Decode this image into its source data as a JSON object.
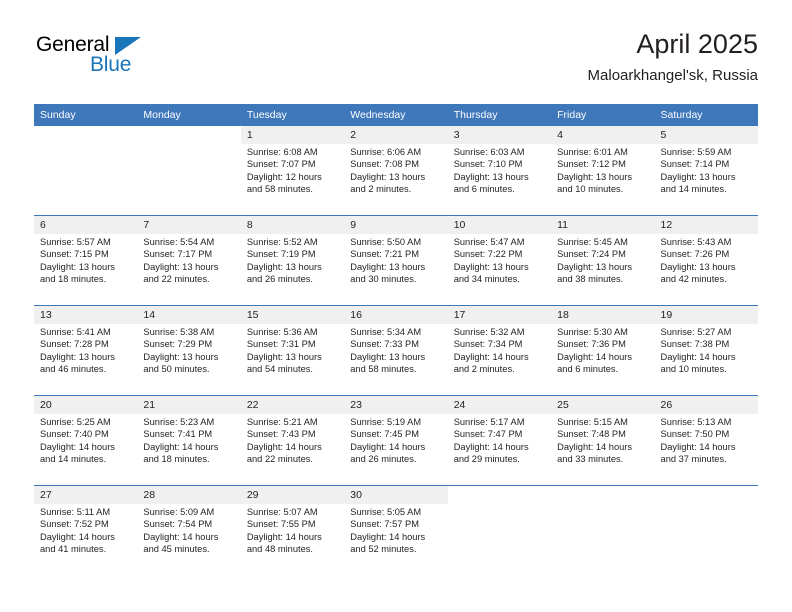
{
  "brand": {
    "name_top": "General",
    "name_bottom": "Blue",
    "accent_color": "#1b75bb"
  },
  "header": {
    "title": "April 2025",
    "location": "Maloarkhangel'sk, Russia"
  },
  "theme": {
    "header_row_bg": "#3f77bb",
    "header_row_text": "#ffffff",
    "daynum_band_bg": "#f0f0f0",
    "grid_line": "#3f77bb",
    "body_text": "#231f20"
  },
  "calendar": {
    "weekday_headers": [
      "Sunday",
      "Monday",
      "Tuesday",
      "Wednesday",
      "Thursday",
      "Friday",
      "Saturday"
    ],
    "labels": {
      "sunrise": "Sunrise:",
      "sunset": "Sunset:",
      "daylight": "Daylight:"
    },
    "weeks": [
      [
        {
          "empty": true
        },
        {
          "empty": true
        },
        {
          "day": "1",
          "sunrise": "Sunrise: 6:08 AM",
          "sunset": "Sunset: 7:07 PM",
          "daylight": "Daylight: 12 hours and 58 minutes."
        },
        {
          "day": "2",
          "sunrise": "Sunrise: 6:06 AM",
          "sunset": "Sunset: 7:08 PM",
          "daylight": "Daylight: 13 hours and 2 minutes."
        },
        {
          "day": "3",
          "sunrise": "Sunrise: 6:03 AM",
          "sunset": "Sunset: 7:10 PM",
          "daylight": "Daylight: 13 hours and 6 minutes."
        },
        {
          "day": "4",
          "sunrise": "Sunrise: 6:01 AM",
          "sunset": "Sunset: 7:12 PM",
          "daylight": "Daylight: 13 hours and 10 minutes."
        },
        {
          "day": "5",
          "sunrise": "Sunrise: 5:59 AM",
          "sunset": "Sunset: 7:14 PM",
          "daylight": "Daylight: 13 hours and 14 minutes."
        }
      ],
      [
        {
          "day": "6",
          "sunrise": "Sunrise: 5:57 AM",
          "sunset": "Sunset: 7:15 PM",
          "daylight": "Daylight: 13 hours and 18 minutes."
        },
        {
          "day": "7",
          "sunrise": "Sunrise: 5:54 AM",
          "sunset": "Sunset: 7:17 PM",
          "daylight": "Daylight: 13 hours and 22 minutes."
        },
        {
          "day": "8",
          "sunrise": "Sunrise: 5:52 AM",
          "sunset": "Sunset: 7:19 PM",
          "daylight": "Daylight: 13 hours and 26 minutes."
        },
        {
          "day": "9",
          "sunrise": "Sunrise: 5:50 AM",
          "sunset": "Sunset: 7:21 PM",
          "daylight": "Daylight: 13 hours and 30 minutes."
        },
        {
          "day": "10",
          "sunrise": "Sunrise: 5:47 AM",
          "sunset": "Sunset: 7:22 PM",
          "daylight": "Daylight: 13 hours and 34 minutes."
        },
        {
          "day": "11",
          "sunrise": "Sunrise: 5:45 AM",
          "sunset": "Sunset: 7:24 PM",
          "daylight": "Daylight: 13 hours and 38 minutes."
        },
        {
          "day": "12",
          "sunrise": "Sunrise: 5:43 AM",
          "sunset": "Sunset: 7:26 PM",
          "daylight": "Daylight: 13 hours and 42 minutes."
        }
      ],
      [
        {
          "day": "13",
          "sunrise": "Sunrise: 5:41 AM",
          "sunset": "Sunset: 7:28 PM",
          "daylight": "Daylight: 13 hours and 46 minutes."
        },
        {
          "day": "14",
          "sunrise": "Sunrise: 5:38 AM",
          "sunset": "Sunset: 7:29 PM",
          "daylight": "Daylight: 13 hours and 50 minutes."
        },
        {
          "day": "15",
          "sunrise": "Sunrise: 5:36 AM",
          "sunset": "Sunset: 7:31 PM",
          "daylight": "Daylight: 13 hours and 54 minutes."
        },
        {
          "day": "16",
          "sunrise": "Sunrise: 5:34 AM",
          "sunset": "Sunset: 7:33 PM",
          "daylight": "Daylight: 13 hours and 58 minutes."
        },
        {
          "day": "17",
          "sunrise": "Sunrise: 5:32 AM",
          "sunset": "Sunset: 7:34 PM",
          "daylight": "Daylight: 14 hours and 2 minutes."
        },
        {
          "day": "18",
          "sunrise": "Sunrise: 5:30 AM",
          "sunset": "Sunset: 7:36 PM",
          "daylight": "Daylight: 14 hours and 6 minutes."
        },
        {
          "day": "19",
          "sunrise": "Sunrise: 5:27 AM",
          "sunset": "Sunset: 7:38 PM",
          "daylight": "Daylight: 14 hours and 10 minutes."
        }
      ],
      [
        {
          "day": "20",
          "sunrise": "Sunrise: 5:25 AM",
          "sunset": "Sunset: 7:40 PM",
          "daylight": "Daylight: 14 hours and 14 minutes."
        },
        {
          "day": "21",
          "sunrise": "Sunrise: 5:23 AM",
          "sunset": "Sunset: 7:41 PM",
          "daylight": "Daylight: 14 hours and 18 minutes."
        },
        {
          "day": "22",
          "sunrise": "Sunrise: 5:21 AM",
          "sunset": "Sunset: 7:43 PM",
          "daylight": "Daylight: 14 hours and 22 minutes."
        },
        {
          "day": "23",
          "sunrise": "Sunrise: 5:19 AM",
          "sunset": "Sunset: 7:45 PM",
          "daylight": "Daylight: 14 hours and 26 minutes."
        },
        {
          "day": "24",
          "sunrise": "Sunrise: 5:17 AM",
          "sunset": "Sunset: 7:47 PM",
          "daylight": "Daylight: 14 hours and 29 minutes."
        },
        {
          "day": "25",
          "sunrise": "Sunrise: 5:15 AM",
          "sunset": "Sunset: 7:48 PM",
          "daylight": "Daylight: 14 hours and 33 minutes."
        },
        {
          "day": "26",
          "sunrise": "Sunrise: 5:13 AM",
          "sunset": "Sunset: 7:50 PM",
          "daylight": "Daylight: 14 hours and 37 minutes."
        }
      ],
      [
        {
          "day": "27",
          "sunrise": "Sunrise: 5:11 AM",
          "sunset": "Sunset: 7:52 PM",
          "daylight": "Daylight: 14 hours and 41 minutes."
        },
        {
          "day": "28",
          "sunrise": "Sunrise: 5:09 AM",
          "sunset": "Sunset: 7:54 PM",
          "daylight": "Daylight: 14 hours and 45 minutes."
        },
        {
          "day": "29",
          "sunrise": "Sunrise: 5:07 AM",
          "sunset": "Sunset: 7:55 PM",
          "daylight": "Daylight: 14 hours and 48 minutes."
        },
        {
          "day": "30",
          "sunrise": "Sunrise: 5:05 AM",
          "sunset": "Sunset: 7:57 PM",
          "daylight": "Daylight: 14 hours and 52 minutes."
        },
        {
          "empty": true
        },
        {
          "empty": true
        },
        {
          "empty": true
        }
      ]
    ]
  }
}
